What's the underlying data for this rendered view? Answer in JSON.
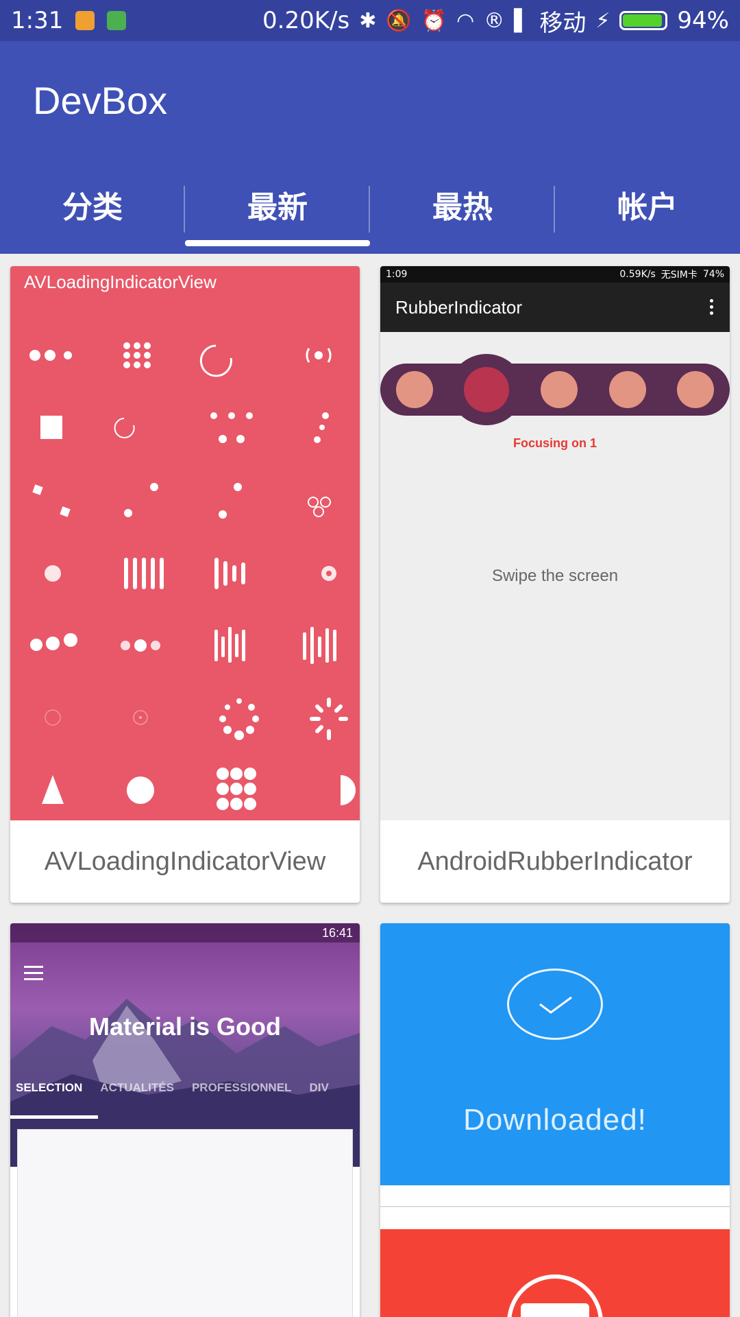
{
  "status_bar": {
    "time": "1:31",
    "net_speed": "0.20K/s",
    "carrier": "移动",
    "battery_percent": "94%",
    "battery_level": 0.94
  },
  "app": {
    "title": "DevBox"
  },
  "tabs": [
    {
      "label": "分类",
      "active": false
    },
    {
      "label": "最新",
      "active": true
    },
    {
      "label": "最热",
      "active": false
    },
    {
      "label": "帐户",
      "active": false
    }
  ],
  "cards": [
    {
      "title": "AVLoadingIndicatorView",
      "preview_header": "AVLoadingIndicatorView",
      "preview_color": "#e85868"
    },
    {
      "title": "AndroidRubberIndicator",
      "preview": {
        "status_time": "1:09",
        "status_speed": "0.59K/s",
        "status_carrier": "无SIM卡",
        "status_battery": "74%",
        "toolbar_title": "RubberIndicator",
        "focus_text": "Focusing on 1",
        "hint_text": "Swipe the screen"
      }
    },
    {
      "preview": {
        "status_time": "16:41",
        "headline": "Material is Good",
        "tabs": [
          "SELECTION",
          "ACTUALITÉS",
          "PROFESSIONNEL",
          "DIV"
        ]
      }
    },
    {
      "preview": {
        "message": "Downloaded!",
        "primary_color": "#2196f3",
        "secondary_color": "#f44336"
      }
    }
  ],
  "colors": {
    "primary": "#3f51b5",
    "primary_dark": "#34429e",
    "accent_red": "#e53935"
  }
}
